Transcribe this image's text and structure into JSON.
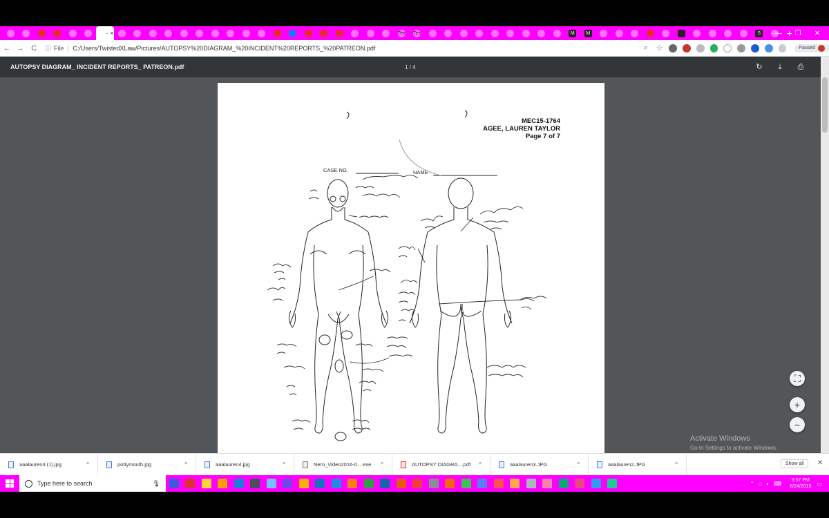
{
  "browser": {
    "tabs": [
      {
        "icon": "generic-icon",
        "color": "#ffffff"
      },
      {
        "icon": "mail-icon",
        "color": "#ffffff"
      },
      {
        "icon": "game-icon",
        "color": "#e52d27"
      },
      {
        "icon": "game-icon",
        "color": "#e52d27"
      },
      {
        "icon": "generic-icon",
        "color": "#ffffff"
      },
      {
        "icon": "generic-icon",
        "color": "#ffffff"
      },
      {
        "icon": "pdf-icon",
        "color": "#ffffff",
        "active": true,
        "label": "· ×"
      },
      {
        "icon": "generic-icon",
        "color": "#ffffff"
      },
      {
        "icon": "generic-icon",
        "color": "#ffffff"
      },
      {
        "icon": "generic-icon",
        "color": "#ffffff"
      },
      {
        "icon": "generic-icon",
        "color": "#ffffff"
      },
      {
        "icon": "generic-icon",
        "color": "#ffffff"
      },
      {
        "icon": "generic-icon",
        "color": "#ffffff"
      },
      {
        "icon": "generic-icon",
        "color": "#ffffff"
      },
      {
        "icon": "generic-icon",
        "color": "#ffffff"
      },
      {
        "icon": "github-icon",
        "color": "#ffffff"
      },
      {
        "icon": "generic-icon",
        "color": "#ffffff"
      },
      {
        "icon": "pinterest-icon",
        "color": "#e52d27"
      },
      {
        "icon": "facebook-icon",
        "color": "#1877f2"
      },
      {
        "icon": "youtube-icon",
        "color": "#e52d27"
      },
      {
        "icon": "youtube-icon",
        "color": "#e52d27"
      },
      {
        "icon": "youtube-icon",
        "color": "#e52d27"
      },
      {
        "icon": "generic-icon",
        "color": "#ffffff"
      },
      {
        "icon": "generic-icon",
        "color": "#ffffff"
      },
      {
        "icon": "generic-icon",
        "color": "#ffffff"
      },
      {
        "icon": "text-icon",
        "color": "#ffffff",
        "text": "Tex"
      },
      {
        "icon": "text-icon",
        "color": "#ffffff",
        "text": "Tex"
      },
      {
        "icon": "google-icon",
        "color": "#ffffff"
      },
      {
        "icon": "google-icon",
        "color": "#ffffff"
      },
      {
        "icon": "google-icon",
        "color": "#ffffff"
      },
      {
        "icon": "image-icon",
        "color": "#ffffff"
      },
      {
        "icon": "generic-icon",
        "color": "#ffffff"
      },
      {
        "icon": "google-icon",
        "color": "#ffffff"
      },
      {
        "icon": "google-icon",
        "color": "#ffffff"
      },
      {
        "icon": "google-icon",
        "color": "#ffffff"
      },
      {
        "icon": "google-icon",
        "color": "#ffffff"
      },
      {
        "icon": "letter-icon",
        "color": "#222222",
        "text": "M"
      },
      {
        "icon": "letter-icon",
        "color": "#222222",
        "text": "M"
      },
      {
        "icon": "generic-icon",
        "color": "#ffffff"
      },
      {
        "icon": "generic-icon",
        "color": "#ffffff"
      },
      {
        "icon": "google-icon",
        "color": "#ffffff"
      },
      {
        "icon": "red-icon",
        "color": "#e52d27"
      },
      {
        "icon": "generic-icon",
        "color": "#ffffff"
      },
      {
        "icon": "game-icon",
        "color": "#222222"
      },
      {
        "icon": "generic-icon",
        "color": "#ffffff"
      },
      {
        "icon": "google-icon",
        "color": "#ffffff"
      },
      {
        "icon": "google-icon",
        "color": "#ffffff"
      },
      {
        "icon": "generic-icon",
        "color": "#ffffff"
      },
      {
        "icon": "letter-icon",
        "color": "#222222",
        "text": "S"
      },
      {
        "icon": "google-icon",
        "color": "#ffffff"
      }
    ],
    "new_tab_label": "+",
    "back_icon": "←",
    "forward_icon": "→",
    "reload_icon": "C",
    "scheme_label": "File",
    "url": "C:/Users/TwistedXLaw/Pictures/AUTOPSY%20DIAGRAM_%20INCIDENT%20REPORTS_%20PATREON.pdf",
    "paused_label": "Paused",
    "window_controls": [
      "—",
      "❐",
      "✕"
    ]
  },
  "pdf_viewer": {
    "title": "AUTOPSY DIAGRAM_ INCIDENT REPORTS_ PATREON.pdf",
    "page_indicator": "1 / 4",
    "rotate_icon": "↻",
    "download_icon": "⤓",
    "print_icon": "⎙"
  },
  "document": {
    "case_number": "MEC15-1764",
    "name": "AGEE, LAUREN TAYLOR",
    "page_label": "Page 7 of 7",
    "case_no_label": "CASE NO.",
    "name_label": "NAME"
  },
  "zoom": {
    "fit_icon": "⛶",
    "plus": "+",
    "minus": "−"
  },
  "watermark": {
    "line1": "Activate Windows",
    "line2": "Go to Settings to activate Windows."
  },
  "downloads": {
    "items": [
      {
        "name": "aaalauren4 (1).jpg",
        "type": "image"
      },
      {
        "name": "pottymouth.jpg",
        "type": "image"
      },
      {
        "name": "aaalauren4.jpg",
        "type": "image"
      },
      {
        "name": "Nero_Video2016-0....exe",
        "type": "exe"
      },
      {
        "name": "AUTOPSY DIAGRA....pdf",
        "type": "pdf"
      },
      {
        "name": "aaalauren3.JPG",
        "type": "image"
      },
      {
        "name": "aaalauren2.JPG",
        "type": "image"
      }
    ],
    "show_all": "Show all",
    "close": "✕"
  },
  "taskbar": {
    "search_placeholder": "Type here to search",
    "apps": [
      "#3b5bdb",
      "#e03131",
      "#ffd43b",
      "#f59f00",
      "#1c7ed6",
      "#495057",
      "#74c0fc",
      "#7048e8",
      "#fab005",
      "#1971c2",
      "#228be6",
      "#fd7e14",
      "#2f9e44",
      "#1864ab",
      "#e8590c",
      "#f03e3e",
      "#868e96",
      "#f76707",
      "#40c057",
      "#5c7cfa",
      "#fa5252",
      "#ffa94d",
      "#adb5bd",
      "#f783ac",
      "#0ca678",
      "#e64980",
      "#339af0",
      "#20c997"
    ],
    "time": "9:57 PM",
    "date": "6/24/2019"
  }
}
